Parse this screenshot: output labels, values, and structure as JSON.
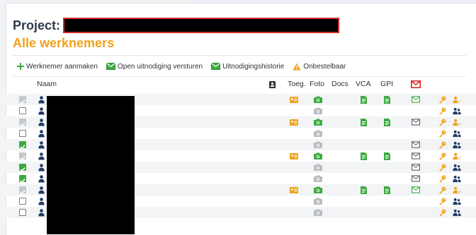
{
  "project": {
    "label": "Project:"
  },
  "page": {
    "title": "Alle werknemers"
  },
  "toolbar": {
    "items": [
      {
        "label": "Werknemer aanmaken",
        "icon": "plus-icon"
      },
      {
        "label": "Open uitnodiging versturen",
        "icon": "envelope-icon"
      },
      {
        "label": "Uitnodigingshistorie",
        "icon": "envelope-icon"
      },
      {
        "label": "Onbestelbaar",
        "icon": "warning-icon"
      }
    ]
  },
  "table": {
    "headers": {
      "name": "Naam",
      "toeg": "Toeg.",
      "foto": "Foto",
      "docs": "Docs",
      "vca": "VCA",
      "gpi": "GPI"
    },
    "rows": [
      {
        "check": "grey",
        "toeg": true,
        "foto": "green",
        "vca": true,
        "gpi": true,
        "mail": "green",
        "user": "edit"
      },
      {
        "check": "empty",
        "toeg": false,
        "foto": "grey",
        "vca": false,
        "gpi": false,
        "mail": "none",
        "user": "group"
      },
      {
        "check": "grey",
        "toeg": true,
        "foto": "green",
        "vca": true,
        "gpi": true,
        "mail": "grey",
        "user": "edit"
      },
      {
        "check": "empty",
        "toeg": false,
        "foto": "grey",
        "vca": false,
        "gpi": false,
        "mail": "none",
        "user": "group"
      },
      {
        "check": "green",
        "toeg": false,
        "foto": "grey",
        "vca": false,
        "gpi": false,
        "mail": "grey",
        "user": "group"
      },
      {
        "check": "grey",
        "toeg": true,
        "foto": "green",
        "vca": true,
        "gpi": true,
        "mail": "grey",
        "user": "edit"
      },
      {
        "check": "green",
        "toeg": false,
        "foto": "grey",
        "vca": false,
        "gpi": false,
        "mail": "grey",
        "user": "group"
      },
      {
        "check": "green",
        "toeg": false,
        "foto": "grey",
        "vca": false,
        "gpi": false,
        "mail": "grey",
        "user": "group"
      },
      {
        "check": "grey",
        "toeg": true,
        "foto": "green",
        "vca": true,
        "gpi": true,
        "mail": "green",
        "user": "edit"
      },
      {
        "check": "empty",
        "toeg": false,
        "foto": "grey",
        "vca": false,
        "gpi": false,
        "mail": "none",
        "user": "group"
      },
      {
        "check": "empty",
        "toeg": false,
        "foto": "grey",
        "vca": false,
        "gpi": false,
        "mail": "none",
        "user": "group"
      }
    ]
  },
  "colors": {
    "accent_orange": "#f0a21d",
    "green": "#3bab3f",
    "red": "#d42a2a",
    "navy": "#1f3b63",
    "grey": "#b8bcc2"
  }
}
